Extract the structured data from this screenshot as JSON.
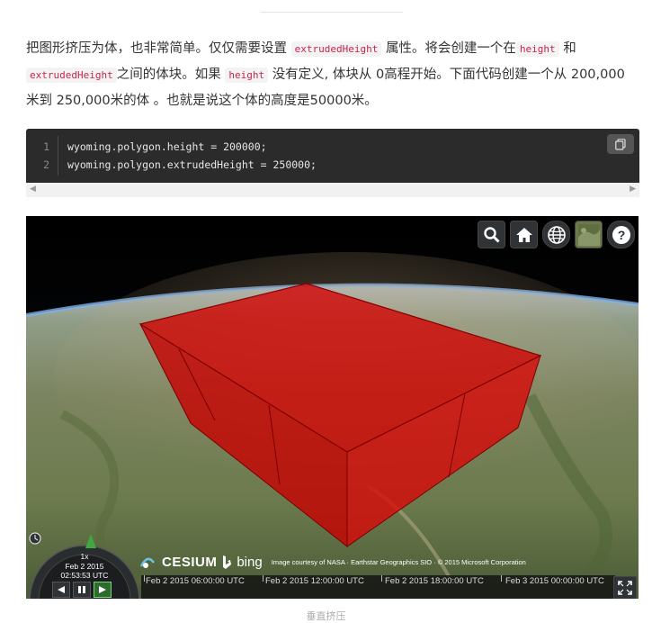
{
  "intro": {
    "part1": "把图形挤压为体，也非常简单。仅仅需要设置",
    "code1": "extrudedHeight",
    "part2": "属性。将会创建一个在",
    "code2": "height",
    "part3": "和",
    "code3": "extrudedHeight",
    "part4": "之间的体块。如果",
    "code4": "height",
    "part5": "没有定义, 体块从 0高程开始。下面代码创建一个从 200,000米到 250,000米的体 。也就是说这个体的高度是50000米。"
  },
  "code_block": {
    "lines": [
      {
        "num": "1",
        "text": "wyoming.polygon.height = 200000;"
      },
      {
        "num": "2",
        "text": "wyoming.polygon.extrudedHeight = 250000;"
      }
    ],
    "copy_icon": "copy-icon"
  },
  "viewer": {
    "toolbar": [
      "search-icon",
      "home-icon",
      "globe-icon",
      "imagery-icon",
      "help-icon"
    ],
    "animation": {
      "speed": "1x",
      "date": "Feb 2 2015",
      "time": "02:53:53 UTC"
    },
    "credits": {
      "cesium": "CESIUM",
      "bing": "bing",
      "attribution": "Image courtesy of NASA · Earthstar Geographics SIO · © 2015 Microsoft Corporation"
    },
    "timeline_ticks": [
      "Feb 2 2015 06:00:00 UTC",
      "Feb 2 2015 12:00:00 UTC",
      "Feb 2 2015 18:00:00 UTC",
      "Feb 3 2015 00:00:00 UTC"
    ],
    "colors": {
      "volume": "#d40000",
      "toolbar_bg": "#303336"
    }
  },
  "caption": "垂直挤压"
}
